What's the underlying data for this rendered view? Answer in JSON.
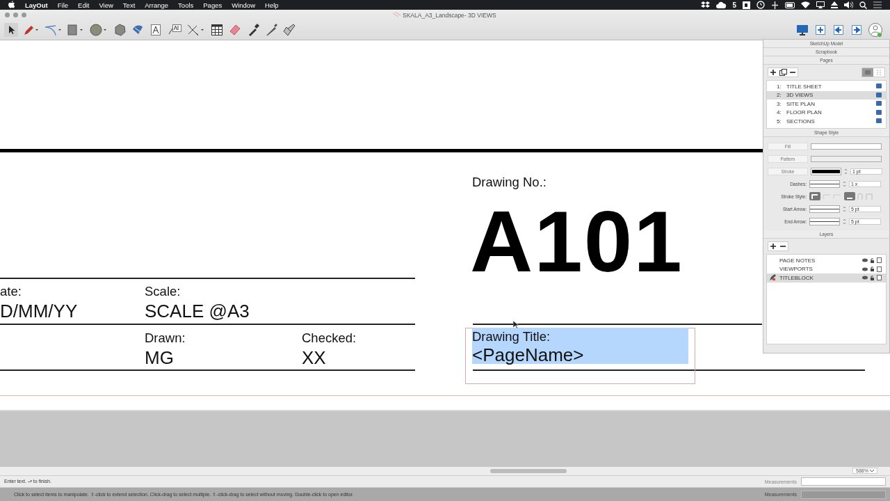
{
  "menu_bar": {
    "app": "LayOut",
    "items": [
      "File",
      "Edit",
      "View",
      "Text",
      "Arrange",
      "Tools",
      "Pages",
      "Window",
      "Help"
    ],
    "badge": "5"
  },
  "window": {
    "title": "SKALA_A3_Landscape- 3D VIEWS"
  },
  "sheet": {
    "drawing_no_label": "Drawing No.:",
    "drawing_no": "A101",
    "fields": [
      {
        "label": "ate:",
        "value": "D/MM/YY"
      },
      {
        "label": "Scale:",
        "value": "SCALE @A3"
      },
      {
        "label": "Drawn:",
        "value": "MG"
      },
      {
        "label": "Checked:",
        "value": "XX"
      }
    ],
    "title_label": "Drawing Title:",
    "title_value": "<PageName>",
    "title_selected": true
  },
  "panel": {
    "collapsed_sections": [
      "SketchUp Model",
      "Scrapbook"
    ],
    "pages_title": "Pages",
    "pages": [
      {
        "number": "1:",
        "name": "TITLE SHEET",
        "selected": false
      },
      {
        "number": "2:",
        "name": "3D VIEWS",
        "selected": true
      },
      {
        "number": "3:",
        "name": "SITE PLAN",
        "selected": false
      },
      {
        "number": "4:",
        "name": "FLOOR PLAN",
        "selected": false
      },
      {
        "number": "5:",
        "name": "SECTIONS",
        "selected": false
      }
    ],
    "shape_style_title": "Shape Style",
    "style_rows": [
      {
        "kind": "fill",
        "label": "Fill"
      },
      {
        "kind": "pattern",
        "label": "Pattern"
      },
      {
        "kind": "stroke",
        "label": "Stroke",
        "value": "1 pt"
      },
      {
        "kind": "select",
        "label": "Dashes:",
        "value": "1 x"
      },
      {
        "kind": "styles",
        "label": "Stroke Style:"
      },
      {
        "kind": "select",
        "label": "Start Arrow:",
        "value": "5 pt"
      },
      {
        "kind": "select",
        "label": "End Arrow:",
        "value": "5 pt"
      }
    ],
    "layers_title": "Layers",
    "layers": [
      {
        "name": "PAGE NOTES",
        "selected": false
      },
      {
        "name": "VIEWPORTS",
        "selected": false
      },
      {
        "name": "TITLEBLOCK",
        "selected": true
      }
    ]
  },
  "zoom": "588%",
  "status_bar": {
    "hint": "Enter text. ⮐ to finish.",
    "measurements": "Measurements"
  },
  "background_bar": {
    "hint": "Click to select items to manipulate. ⇧-click to extend selection. Click-drag to select multiple. ⇧-click-drag to select without moving. Double-click to open editor.",
    "measurements": "Measurements"
  }
}
